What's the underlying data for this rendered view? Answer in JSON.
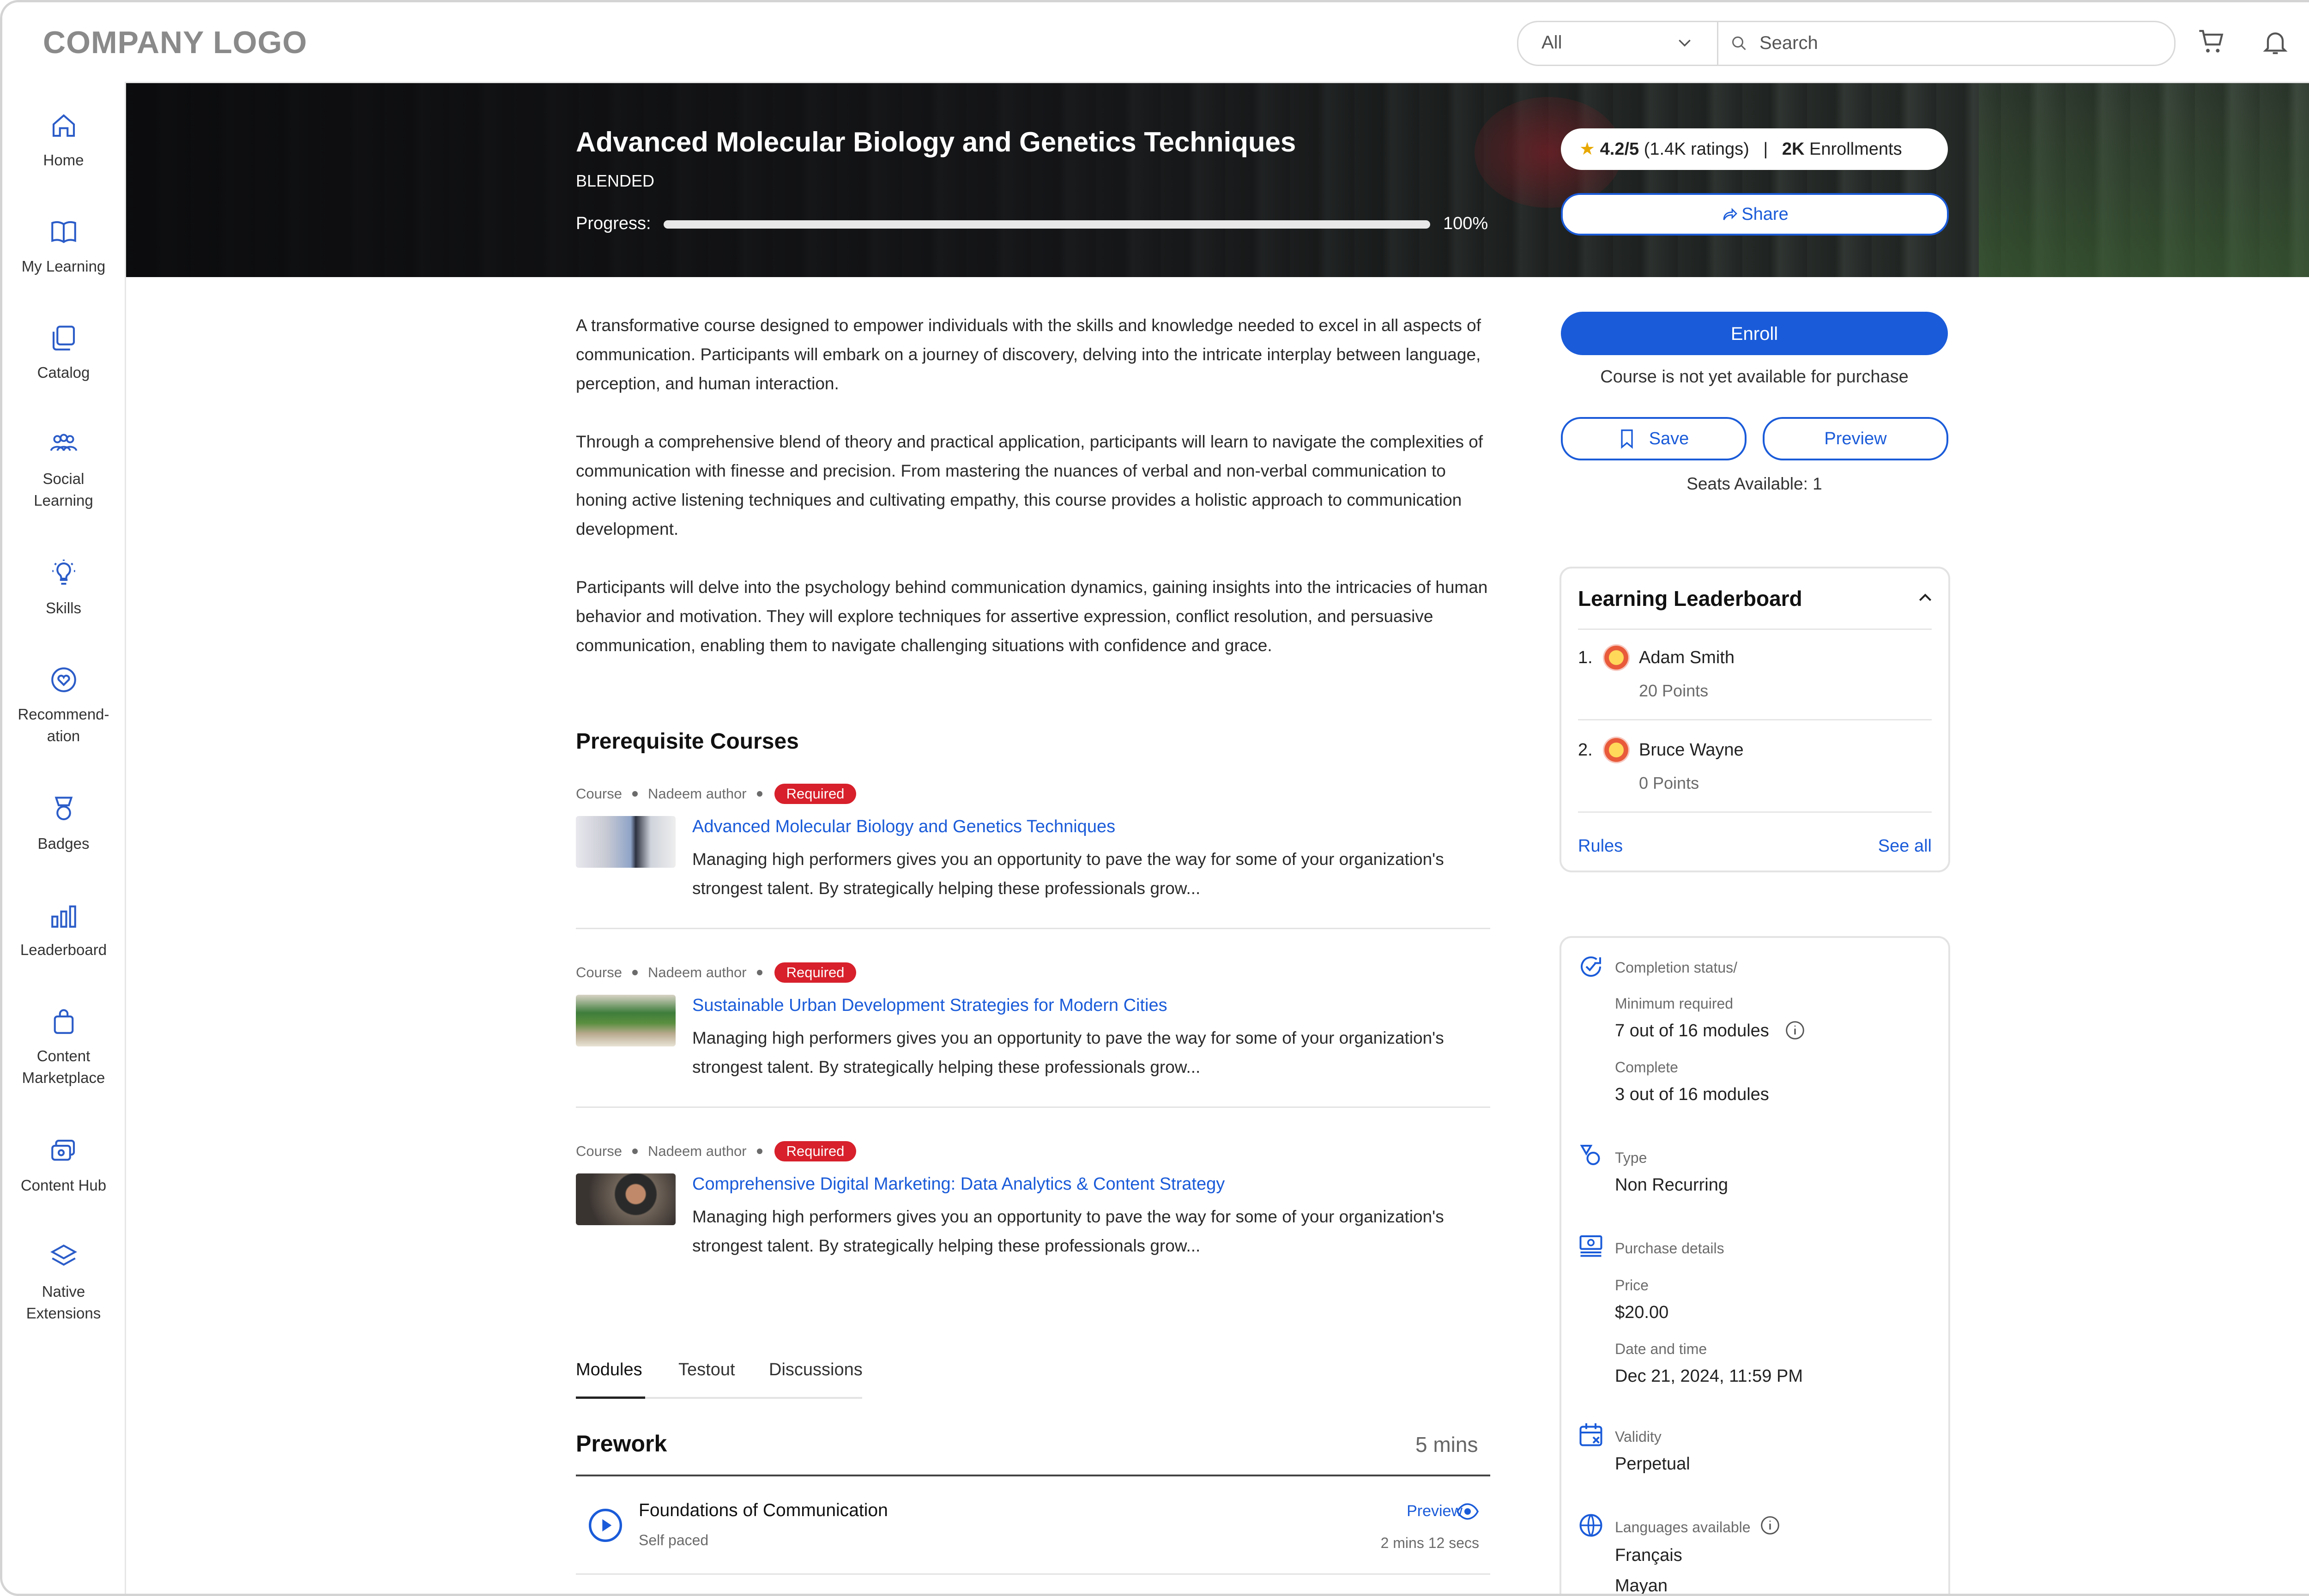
{
  "header": {
    "logo": "COMPANY LOGO",
    "search_scope": "All",
    "search_placeholder": "Search",
    "icons": [
      "cart-icon",
      "bell-icon",
      "avatar"
    ]
  },
  "sidebar": {
    "items": [
      {
        "label": "Home",
        "icon": "home-icon"
      },
      {
        "label": "My Learning",
        "icon": "book-icon"
      },
      {
        "label": "Catalog",
        "icon": "catalog-icon"
      },
      {
        "label_line1": "Social",
        "label_line2": "Learning",
        "icon": "people-icon"
      },
      {
        "label": "Skills",
        "icon": "lightbulb-icon"
      },
      {
        "label_line1": "Recommend-",
        "label_line2": "ation",
        "icon": "heart-badge-icon"
      },
      {
        "label": "Badges",
        "icon": "badge-icon"
      },
      {
        "label": "Leaderboard",
        "icon": "chart-bars-icon"
      },
      {
        "label_line1": "Content",
        "label_line2": "Marketplace",
        "icon": "shopping-bag-icon"
      },
      {
        "label": "Content Hub",
        "icon": "content-hub-icon"
      },
      {
        "label_line1": "Native",
        "label_line2": "Extensions",
        "icon": "layers-icon"
      }
    ]
  },
  "hero": {
    "title": "Advanced Molecular Biology and Genetics Techniques",
    "type": "BLENDED",
    "progress_label": "Progress:",
    "progress_value": 1.0,
    "progress_text": "100%",
    "rating": "4.2/5",
    "ratings_count": "(1.4K ratings)",
    "separator": "|",
    "enrollments": "2K",
    "enrollments_label": "Enrollments",
    "share_label": "Share"
  },
  "description": [
    "A transformative course designed to empower individuals with the skills and knowledge needed to excel in all aspects of communication. Participants will embark on a journey of discovery, delving into the intricate interplay between language, perception, and human interaction.",
    "Through a comprehensive blend of theory and practical application, participants will learn to navigate the complexities of communication with finesse and precision. From mastering the nuances of verbal and non-verbal communication to honing active listening techniques and cultivating empathy, this course provides a holistic approach to communication development.",
    "Participants will delve into the psychology behind communication dynamics, gaining insights into the intricacies of human behavior and motivation. They will explore techniques for assertive expression, conflict resolution, and persuasive communication, enabling them to navigate challenging situations with confidence and grace."
  ],
  "prerequisites": {
    "title": "Prerequisite Courses",
    "items": [
      {
        "kind": "Course",
        "author": "Nadeem author",
        "badge": "Required",
        "title": "Advanced Molecular Biology and Genetics Techniques",
        "desc": "Managing high performers gives you an opportunity to pave the way for some of your organization's strongest talent. By strategically helping these professionals grow..."
      },
      {
        "kind": "Course",
        "author": "Nadeem author",
        "badge": "Required",
        "title": "Sustainable Urban Development Strategies for Modern Cities",
        "desc": "Managing high performers gives you an opportunity to pave the way for some of your organization's strongest talent. By strategically helping these professionals grow..."
      },
      {
        "kind": "Course",
        "author": "Nadeem author",
        "badge": "Required",
        "title": "Comprehensive Digital Marketing: Data Analytics & Content Strategy",
        "desc": "Managing high performers gives you an opportunity to pave the way for some of your organization's strongest talent. By strategically helping these professionals grow..."
      }
    ]
  },
  "tabs": [
    "Modules",
    "Testout",
    "Discussions"
  ],
  "prework": {
    "title": "Prework",
    "duration": "5 mins",
    "module": {
      "title": "Foundations of Communication",
      "type": "Self paced",
      "preview": "Preview",
      "time": "2 mins 12 secs"
    }
  },
  "actions": {
    "enroll": "Enroll",
    "note": "Course is not yet available for purchase",
    "save": "Save",
    "preview": "Preview",
    "seats": "Seats Available: 1"
  },
  "leaderboard": {
    "title": "Learning Leaderboard",
    "entries": [
      {
        "rank": "1.",
        "name": "Adam Smith",
        "points": "20 Points"
      },
      {
        "rank": "2.",
        "name": "Bruce Wayne",
        "points": "0 Points"
      }
    ],
    "rules": "Rules",
    "see_all": "See all"
  },
  "details": {
    "completion_label": "Completion status/",
    "min_required_label": "Minimum required",
    "min_required_value": "7 out of 16 modules",
    "complete_label": "Complete",
    "complete_value": "3 out of 16 modules",
    "type_label": "Type",
    "type_value": "Non Recurring",
    "purchase_label": "Purchase details",
    "price_label": "Price",
    "price_value": "$20.00",
    "datetime_label": "Date and time",
    "datetime_value": "Dec 21, 2024, 11:59 PM",
    "validity_label": "Validity",
    "validity_value": "Perpetual",
    "languages_label": "Languages available",
    "languages": [
      "Français",
      "Mayan"
    ]
  },
  "colors": {
    "accent": "#1a5bd9",
    "required": "#d7202b",
    "text": "#222222",
    "muted": "#6b6b6b"
  }
}
